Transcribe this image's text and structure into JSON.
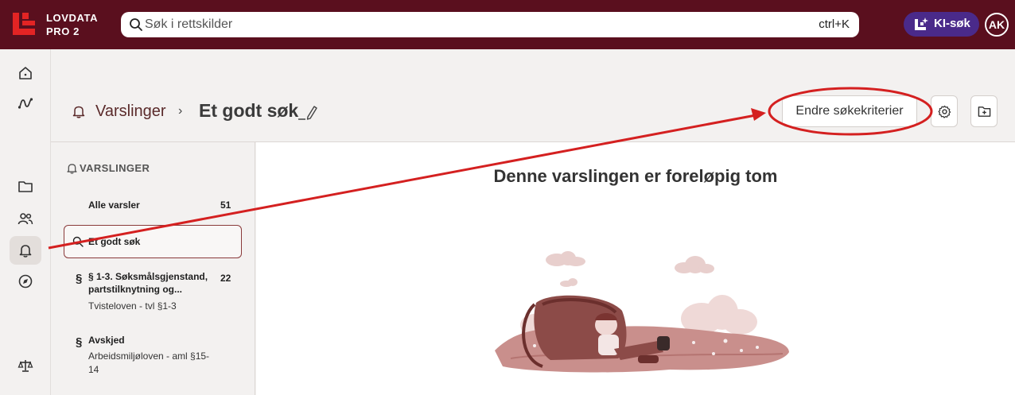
{
  "topbar": {
    "brand_line1": "LOVDATA",
    "brand_line2": "PRO 2",
    "search_placeholder": "Søk i rettskilder",
    "search_shortcut": "ctrl+K",
    "ki_label": "KI-søk",
    "avatar_initials": "AK",
    "bg_color": "#5a0f1e",
    "ki_color": "#4a2a8a",
    "logo_color": "#e32424"
  },
  "rail": {
    "items": [
      "home-icon",
      "activity-icon",
      "folder-icon",
      "users-icon",
      "bell-icon",
      "compass-icon",
      "scales-icon"
    ],
    "active": "bell-icon"
  },
  "header": {
    "breadcrumb_link": "Varslinger",
    "breadcrumb_sep": "›",
    "title": "Et godt søk",
    "edit_criteria_label": "Endre søkekriterier",
    "settings_icon": "gear-icon",
    "save_icon": "folder-plus-icon"
  },
  "panel": {
    "title": "VARSLINGER",
    "all_alerts_label": "Alle varsler",
    "all_alerts_count": "51",
    "selected_label": "Et godt søk",
    "items": [
      {
        "label_line1": "§ 1-3. Søksmålsgjenstand,",
        "label_line2": "partstilknytning og...",
        "count": "22",
        "sub": "Tvisteloven - tvl §1-3"
      },
      {
        "label_line1": "Avskjed",
        "count": "",
        "sub_line1": "Arbeidsmiljøloven - aml §15-",
        "sub_line2": "14"
      }
    ],
    "section_symbol": "§"
  },
  "main": {
    "empty_title": "Denne varslingen er foreløpig tom"
  },
  "annotation_color": "#d42020"
}
